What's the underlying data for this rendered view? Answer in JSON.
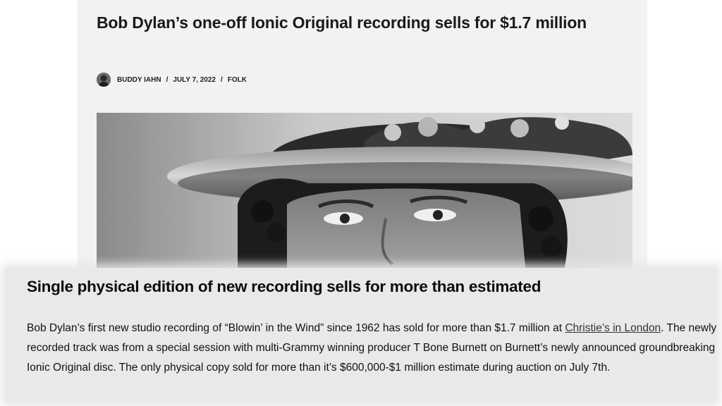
{
  "article": {
    "headline": "Bob Dylan’s one-off Ionic Original recording sells for $1.7 million",
    "author": "BUDDY IAHN",
    "separator": "/",
    "date": "JULY 7, 2022",
    "category": "FOLK"
  },
  "overlay": {
    "subheading": "Single physical edition of new recording sells for more than estimated",
    "body_part1": "Bob Dylan’s first new studio recording of “Blowin’ in the Wind” since 1962 has sold for more than $1.7 million at ",
    "link_text": "Christie’s in London",
    "body_part2": ". The newly recorded track was from a special session with multi-Grammy winning producer T Bone Burnett on Burnett’s newly announced groundbreaking Ionic Original disc. The only physical copy sold for more than it’s $600,000-$1 million estimate during auction on July 7th."
  },
  "colors": {
    "card_background": "#f2f2f2",
    "overlay_background": "#e9e9e9",
    "text": "#111111"
  },
  "icons": {
    "author_avatar": "avatar"
  }
}
